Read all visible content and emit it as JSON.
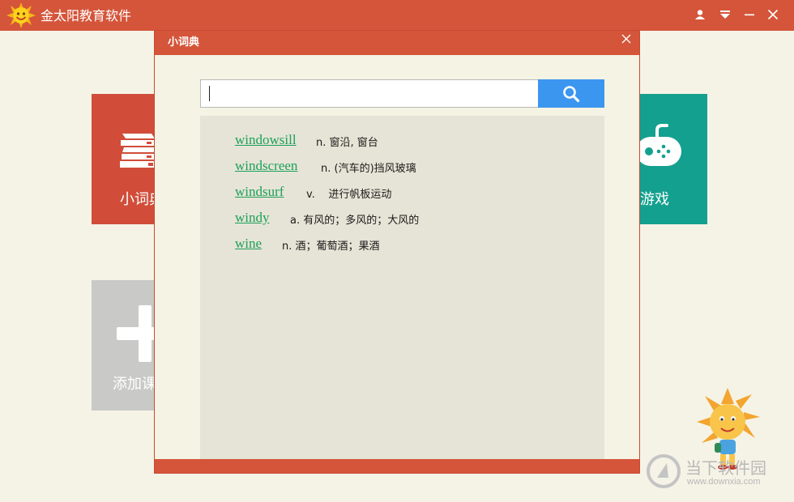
{
  "app": {
    "title": "金太阳教育软件",
    "icons": {
      "logo": "sun-logo-icon",
      "user": "user-icon",
      "menu": "menu-down-icon",
      "minimize": "minimize-icon",
      "close": "close-icon"
    }
  },
  "tiles": {
    "dictionary": {
      "label": "小词典",
      "icon": "books-icon",
      "color": "#d14d39"
    },
    "games": {
      "label": "教育游戏",
      "icon": "gamepad-icon",
      "color": "#14a08f"
    },
    "add": {
      "label": "添加课",
      "icon": "plus-icon",
      "color": "#c9c9c7"
    }
  },
  "dialog": {
    "title": "小词典",
    "search": {
      "value": "",
      "placeholder": ""
    },
    "icons": {
      "search": "search-icon",
      "close": "close-icon"
    },
    "results": [
      {
        "word": "windowsill",
        "definition": "n. 窗沿, 窗台"
      },
      {
        "word": "windscreen",
        "definition": "n. (汽车的)挡风玻璃"
      },
      {
        "word": "windsurf",
        "definition": "v.    进行帆板运动"
      },
      {
        "word": "windy",
        "definition": "a. 有风的；多风的；大风的"
      },
      {
        "word": "wine",
        "definition": "n. 酒；葡萄酒；果酒"
      }
    ]
  },
  "watermark": {
    "brand": "当下软件园",
    "url": "www.downxia.com"
  },
  "colors": {
    "accent": "#d4553a",
    "search_button": "#3b96f0",
    "word_link": "#1ca05b",
    "teal": "#14a08f"
  }
}
